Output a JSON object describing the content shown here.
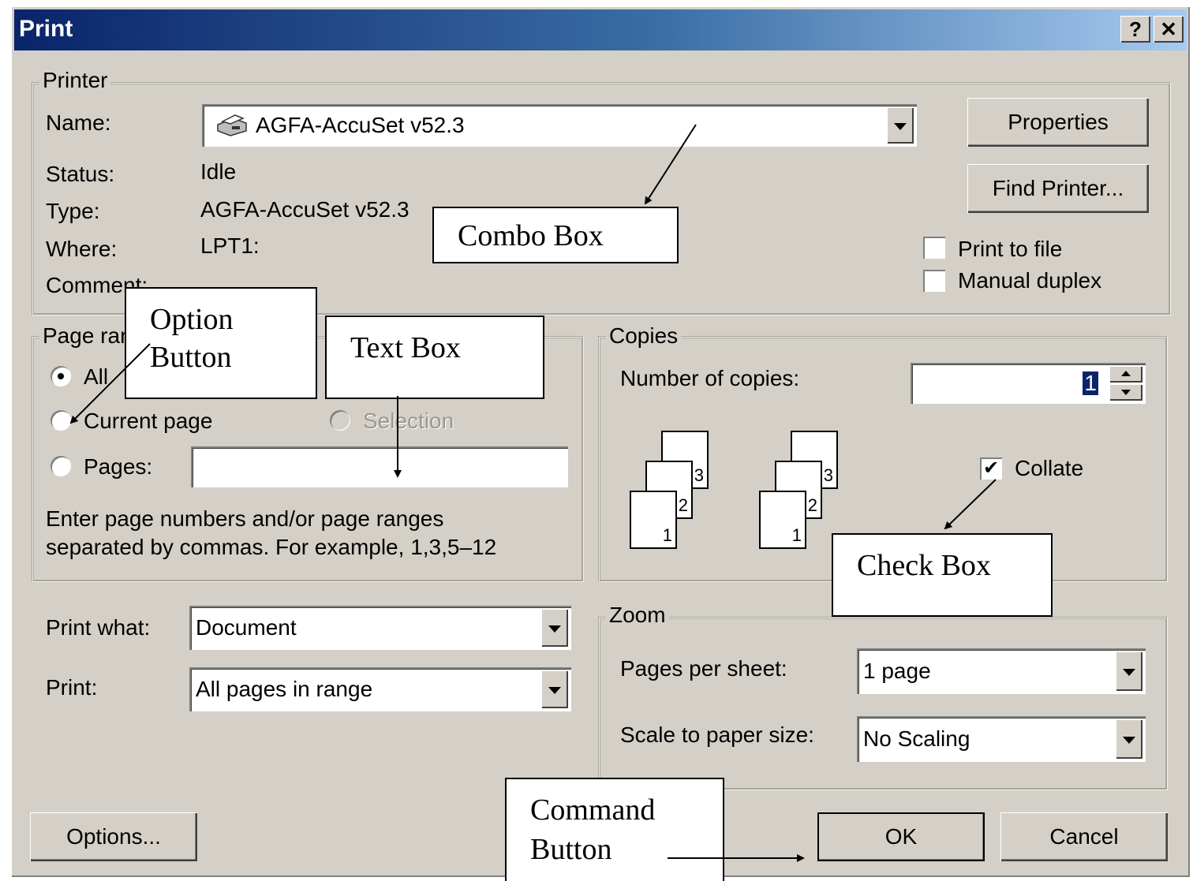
{
  "window": {
    "title": "Print",
    "help_btn": "?",
    "close_btn": "✕"
  },
  "printer": {
    "group_title": "Printer",
    "name_label": "Name:",
    "name_value": "AGFA-AccuSet v52.3",
    "status_label": "Status:",
    "status_value": "Idle",
    "type_label": "Type:",
    "type_value": "AGFA-AccuSet v52.3",
    "where_label": "Where:",
    "where_value": "LPT1:",
    "comment_label": "Comment:",
    "properties_btn": "Properties",
    "find_printer_btn": "Find Printer...",
    "print_to_file": "Print to file",
    "manual_duplex": "Manual duplex"
  },
  "page_range": {
    "group_title": "Page range",
    "all": "All",
    "current_page": "Current page",
    "selection": "Selection",
    "pages": "Pages:",
    "hint_line1": "Enter page numbers and/or page ranges",
    "hint_line2": "separated by commas.  For example, 1,3,5–12"
  },
  "copies": {
    "group_title": "Copies",
    "number_label": "Number of copies:",
    "number_value": "1",
    "collate": "Collate",
    "collate_checked": true,
    "page_nums": [
      "1",
      "2",
      "3"
    ]
  },
  "print_what": {
    "label": "Print what:",
    "value": "Document"
  },
  "print": {
    "label": "Print:",
    "value": "All pages in range"
  },
  "zoom": {
    "group_title": "Zoom",
    "pages_per_sheet_label": "Pages per sheet:",
    "pages_per_sheet_value": "1 page",
    "scale_label": "Scale to paper size:",
    "scale_value": "No Scaling"
  },
  "buttons": {
    "options": "Options...",
    "ok": "OK",
    "cancel": "Cancel"
  },
  "callouts": {
    "combo_box": "Combo Box",
    "option_button_1": "Option",
    "option_button_2": "Button",
    "text_box": "Text Box",
    "check_box": "Check Box",
    "command_button_1": "Command",
    "command_button_2": "Button"
  }
}
